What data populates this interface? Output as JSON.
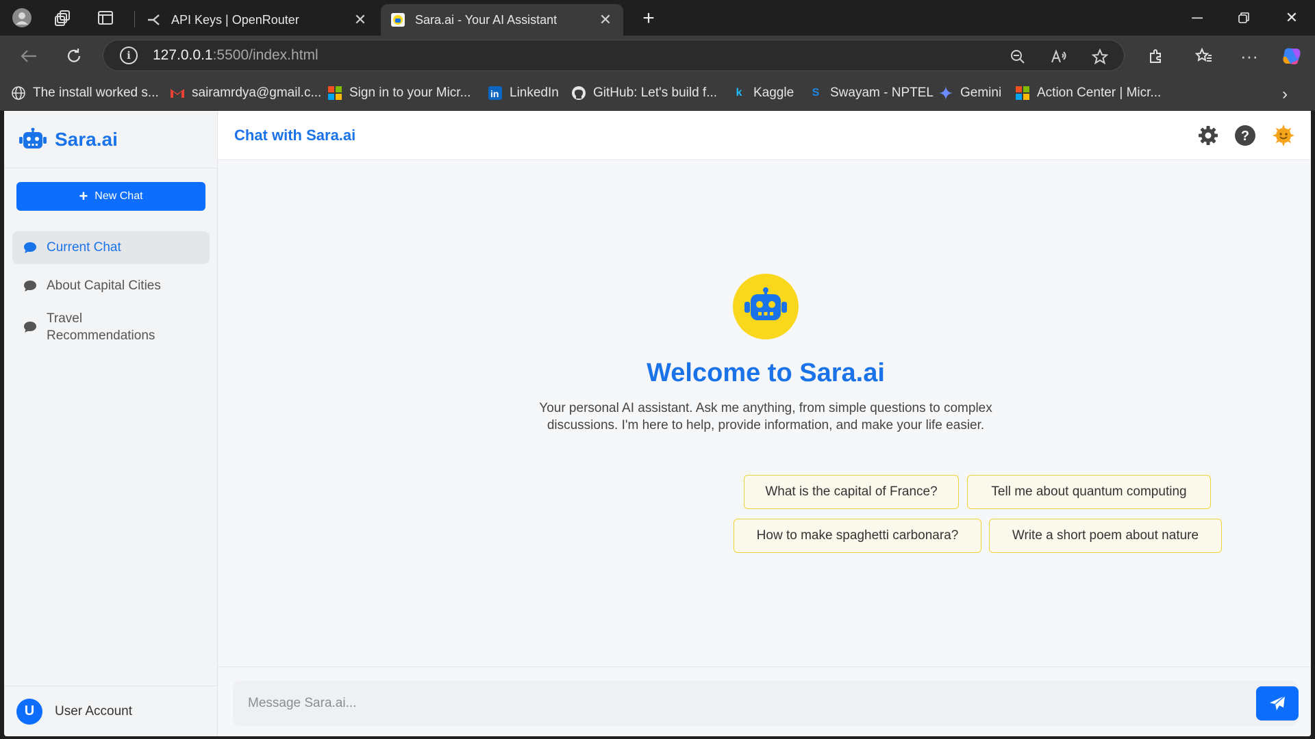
{
  "browser": {
    "tabs": [
      {
        "title": "API Keys | OpenRouter",
        "active": false
      },
      {
        "title": "Sara.ai - Your AI Assistant",
        "active": true
      }
    ],
    "url_host": "127.0.0.1",
    "url_rest": ":5500/index.html",
    "bookmarks": [
      {
        "label": "The install worked s...",
        "icon": "globe-icon"
      },
      {
        "label": "sairamrdya@gmail.c...",
        "icon": "gmail-icon"
      },
      {
        "label": "Sign in to your Micr...",
        "icon": "microsoft-icon"
      },
      {
        "label": "LinkedIn",
        "icon": "linkedin-icon"
      },
      {
        "label": "GitHub: Let's build f...",
        "icon": "github-icon"
      },
      {
        "label": "Kaggle",
        "icon": "kaggle-icon"
      },
      {
        "label": "Swayam - NPTEL",
        "icon": "swayam-icon"
      },
      {
        "label": "Gemini",
        "icon": "gemini-icon"
      },
      {
        "label": "Action Center | Micr...",
        "icon": "microsoft-icon"
      }
    ]
  },
  "sidebar": {
    "brand": "Sara.ai",
    "new_chat_label": "New Chat",
    "chats": [
      {
        "label": "Current Chat",
        "active": true
      },
      {
        "label": "About Capital Cities",
        "active": false
      },
      {
        "label": "Travel Recommendations",
        "active": false
      }
    ],
    "user_initial": "U",
    "user_label": "User Account"
  },
  "main": {
    "header_title": "Chat with Sara.ai",
    "welcome_title": "Welcome to Sara.ai",
    "welcome_desc": "Your personal AI assistant. Ask me anything, from simple questions to complex discussions. I'm here to help, provide information, and make your life easier.",
    "suggestions": [
      "What is the capital of France?",
      "Tell me about quantum computing",
      "How to make spaghetti carbonara?",
      "Write a short poem about nature"
    ],
    "input_placeholder": "Message Sara.ai..."
  },
  "colors": {
    "accent": "#1a73e8",
    "button_blue": "#0d6efd",
    "robot_yellow": "#f9d71c",
    "suggestion_border": "#f0d33a"
  }
}
